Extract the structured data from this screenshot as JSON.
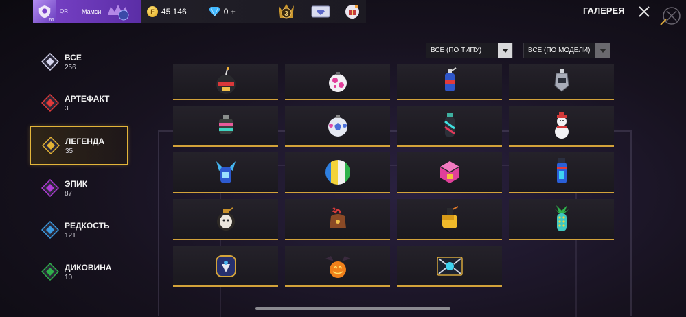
{
  "header": {
    "player_tag": "QR",
    "player_name": "Мамси",
    "level": "61",
    "gold": "45 146",
    "diamonds": "0 +",
    "rank_number": "3",
    "title": "ГАЛЕРЕЯ"
  },
  "sidebar": {
    "items": [
      {
        "label": "ВСЕ",
        "count": "256",
        "color": "#d7d7f0"
      },
      {
        "label": "АРТЕФАКТ",
        "count": "3",
        "color": "#e23a3a"
      },
      {
        "label": "ЛЕГЕНДА",
        "count": "35",
        "color": "#e2b233"
      },
      {
        "label": "ЭПИК",
        "count": "87",
        "color": "#b13ad8"
      },
      {
        "label": "РЕДКОСТЬ",
        "count": "121",
        "color": "#3a9be2"
      },
      {
        "label": "ДИКОВИНА",
        "count": "10",
        "color": "#2eb14a"
      }
    ],
    "active_index": 2
  },
  "filters": {
    "type_label": "ВСЕ (ПО ТИПУ)",
    "model_label": "ВСЕ (ПО МОДЕЛИ)"
  },
  "items": [
    {
      "icon": "bomb-grenade-icon"
    },
    {
      "icon": "pink-ball-grenade-icon"
    },
    {
      "icon": "blue-red-grenade-icon"
    },
    {
      "icon": "silver-grenade-icon"
    },
    {
      "icon": "armored-grenade-icon"
    },
    {
      "icon": "soccer-ball-grenade-icon"
    },
    {
      "icon": "cyan-canister-grenade-icon"
    },
    {
      "icon": "snowman-grenade-icon"
    },
    {
      "icon": "winged-blue-grenade-icon"
    },
    {
      "icon": "beach-ball-grenade-icon"
    },
    {
      "icon": "pink-cube-grenade-icon"
    },
    {
      "icon": "blue-cylinder-grenade-icon"
    },
    {
      "icon": "masked-grenade-icon"
    },
    {
      "icon": "gift-bag-grenade-icon"
    },
    {
      "icon": "golden-fist-grenade-icon"
    },
    {
      "icon": "pineapple-grenade-icon"
    },
    {
      "icon": "crest-sphere-grenade-icon"
    },
    {
      "icon": "pumpkin-grenade-icon"
    },
    {
      "icon": "winged-emblem-grenade-icon"
    }
  ],
  "colors": {
    "accent_gold": "#d2a23a",
    "profile_purple": "#7a43c9"
  }
}
